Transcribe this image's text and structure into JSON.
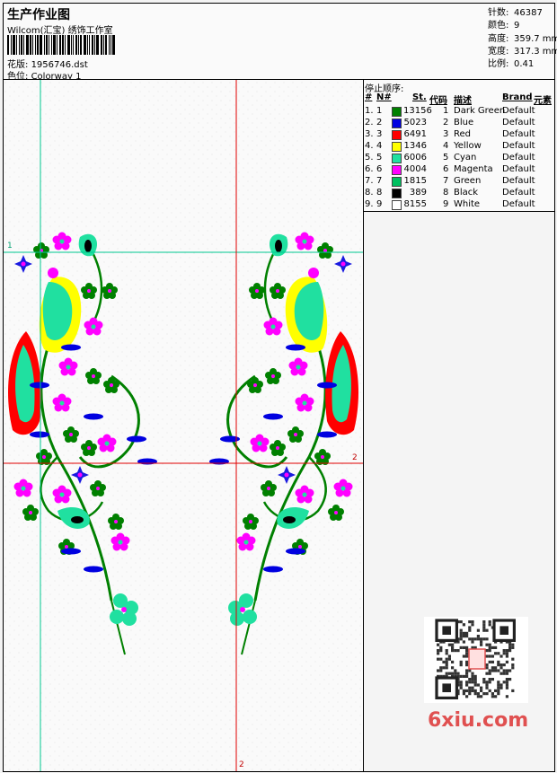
{
  "header": {
    "title": "生产作业图",
    "company": "Wilcom(汇宝) 绣饰工作室",
    "pattern_label": "花版:",
    "pattern_value": "1956746.dst",
    "colorway_label": "色位:",
    "colorway_value": "Colorway 1"
  },
  "stats": {
    "stitches_label": "针数:",
    "stitches_value": "46387",
    "colors_label": "颜色:",
    "colors_value": "9",
    "height_label": "高度:",
    "height_value": "359.7 mm",
    "width_label": "宽度:",
    "width_value": "317.3 mm",
    "scale_label": "比例:",
    "scale_value": "0.41"
  },
  "stop_sequence": {
    "title": "停止顺序:",
    "headers": {
      "num": "#",
      "n": "N#",
      "st": "St.",
      "code": "代码",
      "desc": "描述",
      "brand": "Brand",
      "element": "元素"
    },
    "rows": [
      {
        "num": "1.",
        "n": "1",
        "st": "13156",
        "code": "1",
        "desc": "Dark Green",
        "brand": "Default",
        "color": "#008000"
      },
      {
        "num": "2.",
        "n": "2",
        "st": "5023",
        "code": "2",
        "desc": "Blue",
        "brand": "Default",
        "color": "#0000e0"
      },
      {
        "num": "3.",
        "n": "3",
        "st": "6491",
        "code": "3",
        "desc": "Red",
        "brand": "Default",
        "color": "#ff0000"
      },
      {
        "num": "4.",
        "n": "4",
        "st": "1346",
        "code": "4",
        "desc": "Yellow",
        "brand": "Default",
        "color": "#ffff00"
      },
      {
        "num": "5.",
        "n": "5",
        "st": "6006",
        "code": "5",
        "desc": "Cyan",
        "brand": "Default",
        "color": "#20e0a0"
      },
      {
        "num": "6.",
        "n": "6",
        "st": "4004",
        "code": "6",
        "desc": "Magenta",
        "brand": "Default",
        "color": "#ff00ff"
      },
      {
        "num": "7.",
        "n": "7",
        "st": "1815",
        "code": "7",
        "desc": "Green",
        "brand": "Default",
        "color": "#00c060"
      },
      {
        "num": "8.",
        "n": "8",
        "st": "389",
        "code": "8",
        "desc": "Black",
        "brand": "Default",
        "color": "#000000"
      },
      {
        "num": "9.",
        "n": "9",
        "st": "8155",
        "code": "9",
        "desc": "White",
        "brand": "Default",
        "color": "#ffffff"
      }
    ]
  },
  "guides": {
    "h1_label": "1",
    "h2_label": "2",
    "v2_label": "2"
  },
  "watermark": "6xiu.com",
  "colors": {
    "guide_green": "#00c890",
    "guide_red": "#e00000"
  }
}
